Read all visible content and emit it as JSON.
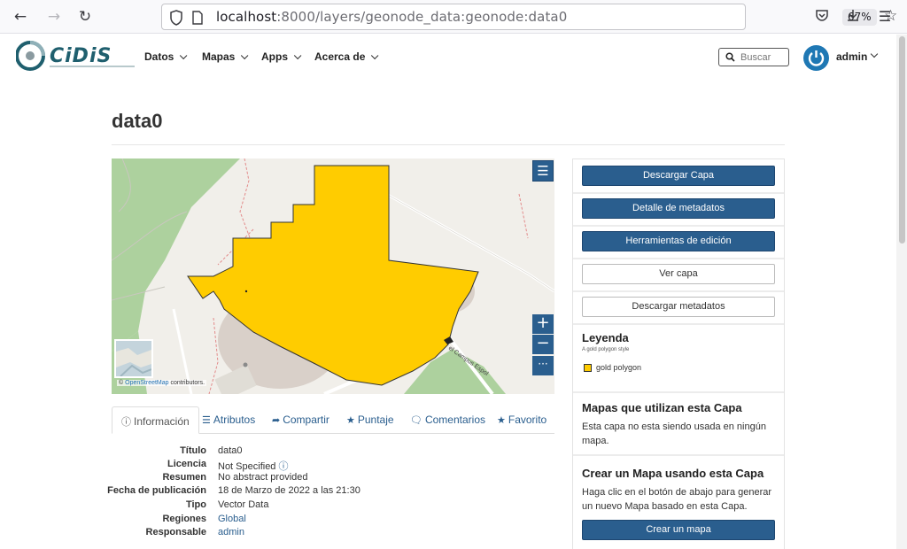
{
  "browser": {
    "url_host": "localhost",
    "url_rest": ":8000/layers/geonode_data:geonode:data0",
    "zoom": "67%"
  },
  "nav": {
    "items": [
      "Datos",
      "Mapas",
      "Apps",
      "Acerca de"
    ],
    "search_placeholder": "Buscar",
    "user": "admin"
  },
  "page": {
    "title": "data0"
  },
  "map": {
    "attribution_prefix": "©",
    "attribution_link": "OpenStreetMap",
    "attribution_suffix": "contributors.",
    "street_label": "el Campus Espol",
    "layer_color": "#ffcc00"
  },
  "tabs": [
    {
      "label": "Información",
      "icon": "info-circle-icon"
    },
    {
      "label": "Atributos",
      "icon": "list-icon"
    },
    {
      "label": "Compartir",
      "icon": "share-icon"
    },
    {
      "label": "Puntaje",
      "icon": "star-icon"
    },
    {
      "label": "Comentarios",
      "icon": "comment-icon"
    },
    {
      "label": "Favorito",
      "icon": "star-icon"
    }
  ],
  "info": [
    {
      "label": "Título",
      "value": "data0"
    },
    {
      "label": "Licencia",
      "value": "Not Specified"
    },
    {
      "label": "Resumen",
      "value": "No abstract provided"
    },
    {
      "label": "Fecha de publicación",
      "value": "18 de Marzo de 2022 a las 21:30"
    },
    {
      "label": "Tipo",
      "value": "Vector Data"
    },
    {
      "label": "Regiones",
      "value": "Global"
    },
    {
      "label": "Responsable",
      "value": "admin"
    }
  ],
  "sidebar": {
    "buttons": {
      "download_layer": "Descargar Capa",
      "metadata_detail": "Detalle de metadatos",
      "edit_tools": "Herramientas de edición",
      "view_layer": "Ver capa",
      "download_metadata": "Descargar metadatos",
      "create_map": "Crear un mapa"
    },
    "legend": {
      "title": "Leyenda",
      "subtitle": "A gold polygon style",
      "item": "gold polygon"
    },
    "maps_using": {
      "title": "Mapas que utilizan esta Capa",
      "text": "Esta capa no esta siendo usada en ningún mapa."
    },
    "create_map": {
      "title": "Crear un Mapa usando esta Capa",
      "text": "Haga clic en el botón de abajo para generar un nuevo Mapa basado en esta Capa."
    }
  }
}
